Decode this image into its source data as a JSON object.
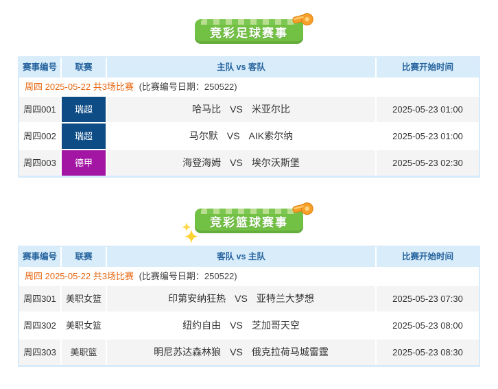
{
  "labels": {
    "vs": "VS"
  },
  "colors": {
    "banner_green": "#72c144",
    "header_bg": "#d8ecfa",
    "header_text": "#27649e",
    "date_orange": "#e7650e",
    "league_swedish_allsvenskan": "#0e4c86",
    "league_bundesliga": "#a315a3",
    "whistle_orange": "#f6a02a",
    "sparkle_gold": "#ffd94f"
  },
  "football": {
    "banner_title": "竞彩足球赛事",
    "headers": [
      "赛事编号",
      "联赛",
      "主队 vs 客队",
      "比赛开始时间"
    ],
    "date_label": "周四 2025-05-22 共3场比赛",
    "date_note": "(比赛编号日期：250522)",
    "rows": [
      {
        "match_no": "周四001",
        "league": "瑞超",
        "league_color": "#0e4c86",
        "team1": "哈马比",
        "team2": "米亚尔比",
        "start_time": "2025-05-23 01:00"
      },
      {
        "match_no": "周四002",
        "league": "瑞超",
        "league_color": "#0e4c86",
        "team1": "马尔默",
        "team2": "AIK索尔纳",
        "start_time": "2025-05-23 01:00"
      },
      {
        "match_no": "周四003",
        "league": "德甲",
        "league_color": "#a315a3",
        "team1": "海登海姆",
        "team2": "埃尔沃斯堡",
        "start_time": "2025-05-23 02:30"
      }
    ]
  },
  "basketball": {
    "banner_title": "竞彩篮球赛事",
    "headers": [
      "赛事编号",
      "联赛",
      "客队 vs 主队",
      "比赛开始时间"
    ],
    "date_label": "周四 2025-05-22 共3场比赛",
    "date_note": "(比赛编号日期：250522)",
    "rows": [
      {
        "match_no": "周四301",
        "league": "美职女篮",
        "team1": "印第安纳狂热",
        "team2": "亚特兰大梦想",
        "start_time": "2025-05-23 07:30"
      },
      {
        "match_no": "周四302",
        "league": "美职女篮",
        "team1": "纽约自由",
        "team2": "芝加哥天空",
        "start_time": "2025-05-23 08:00"
      },
      {
        "match_no": "周四303",
        "league": "美职篮",
        "team1": "明尼苏达森林狼",
        "team2": "俄克拉荷马城雷霆",
        "start_time": "2025-05-23 08:30"
      }
    ]
  }
}
